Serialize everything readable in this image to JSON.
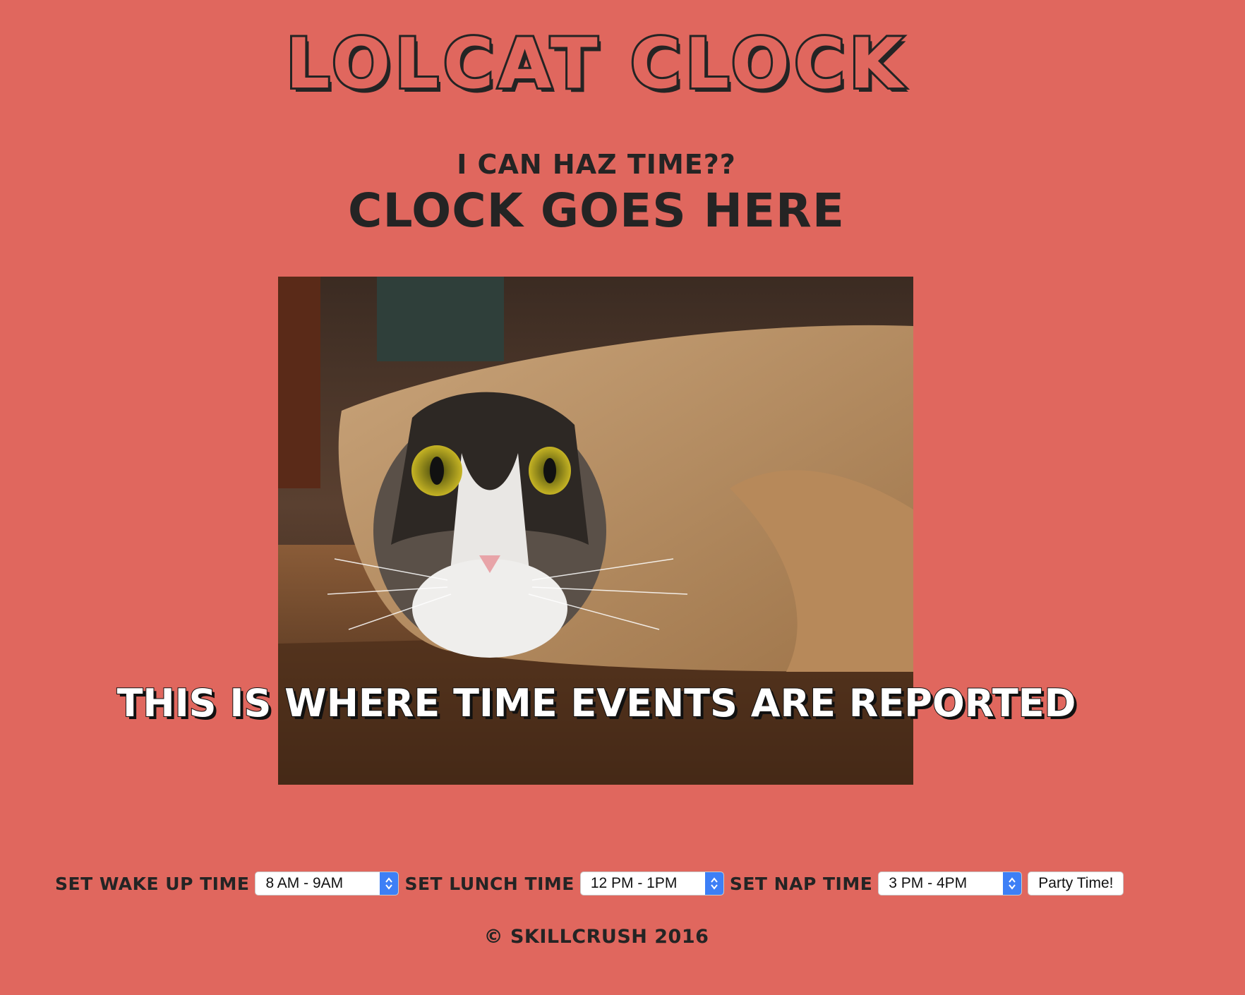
{
  "header": {
    "logo": "Lolcat Clock",
    "subtitle": "I can haz time??",
    "clock": "Clock goes here"
  },
  "photo": {
    "caption": "This is where time events are reported"
  },
  "controls": {
    "wake_label": "Set wake up time",
    "wake_value": "8 AM - 9AM",
    "lunch_label": "Set lunch time",
    "lunch_value": "12 PM - 1PM",
    "nap_label": "Set nap time",
    "nap_value": "3 PM - 4PM",
    "party_button": "Party Time!"
  },
  "footer": {
    "copyright": "© Skillcrush 2016"
  },
  "colors": {
    "background": "#e0675e",
    "text": "#242424",
    "select_accent": "#3d7ff6"
  }
}
